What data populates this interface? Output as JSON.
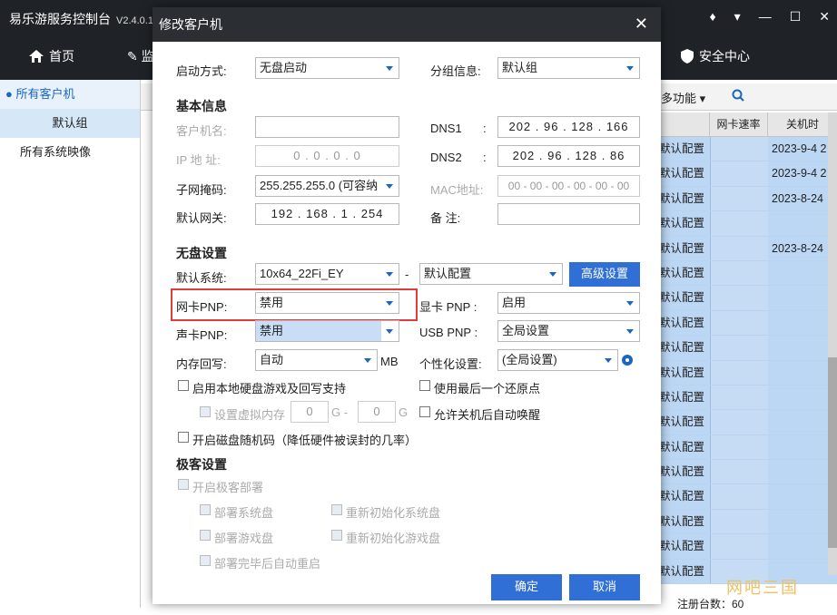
{
  "app": {
    "title": "易乐游服务控制台",
    "version": "V2.4.0.1",
    "nav_home": "首页",
    "nav_second": "监",
    "nav_security": "安全中心"
  },
  "sidebar": {
    "all_clients": "所有客户机",
    "default_group": "默认组",
    "all_images": "所有系统映像"
  },
  "background_table": {
    "more_func": "多功能 ▾",
    "headers": [
      "",
      "网卡速率",
      "关机时"
    ],
    "rows": [
      {
        "config": "默认配置",
        "time": "2023-9-4 2"
      },
      {
        "config": "默认配置",
        "time": "2023-9-4 2"
      },
      {
        "config": "默认配置",
        "time": "2023-8-24"
      },
      {
        "config": "默认配置",
        "time": ""
      },
      {
        "config": "默认配置",
        "time": "2023-8-24"
      },
      {
        "config": "默认配置",
        "time": ""
      },
      {
        "config": "默认配置",
        "time": ""
      },
      {
        "config": "默认配置",
        "time": ""
      },
      {
        "config": "默认配置",
        "time": ""
      },
      {
        "config": "默认配置",
        "time": ""
      },
      {
        "config": "默认配置",
        "time": ""
      },
      {
        "config": "默认配置",
        "time": ""
      },
      {
        "config": "默认配置",
        "time": ""
      },
      {
        "config": "默认配置",
        "time": ""
      },
      {
        "config": "默认配置",
        "time": ""
      },
      {
        "config": "默认配置",
        "time": ""
      },
      {
        "config": "默认配置",
        "time": ""
      },
      {
        "config": "默认配置",
        "time": ""
      }
    ],
    "status": "注册台数：60",
    "watermark": "网吧三国"
  },
  "dialog": {
    "title": "修改客户机",
    "boot_mode_label": "启动方式:",
    "boot_mode_value": "无盘启动",
    "group_label": "分组信息:",
    "group_value": "默认组",
    "basic_info_title": "基本信息",
    "client_name_label": "客户机名:",
    "client_name_value": "",
    "ip_label": "IP 地 址:",
    "ip_value": "0 . 0 . 0 . 0",
    "subnet_label": "子网掩码:",
    "subnet_value": "255.255.255.0 (可容纳",
    "gateway_label": "默认网关:",
    "gateway_value": "192 . 168 . 1 . 254",
    "dns1_label": "DNS1",
    "dns1_value": "202 . 96 . 128 . 166",
    "dns2_label": "DNS2",
    "dns2_value": "202 . 96 . 128 . 86",
    "mac_label": "MAC地址:",
    "mac_value": "00 - 00 - 00 - 00 - 00 - 00",
    "remark_label": "备 注:",
    "remark_value": "",
    "diskless_title": "无盘设置",
    "default_system_label": "默认系统:",
    "default_system_value": "10x64_22Fi_EY",
    "dash": "-",
    "default_config_value": "默认配置",
    "advanced_button": "高级设置",
    "nic_pnp_label": "网卡PNP:",
    "nic_pnp_value": "禁用",
    "gpu_pnp_label": "显卡 PNP :",
    "gpu_pnp_value": "启用",
    "sound_pnp_label": "声卡PNP:",
    "sound_pnp_value": "禁用",
    "usb_pnp_label": "USB PNP :",
    "usb_pnp_value": "全局设置",
    "mem_writeback_label": "内存回写:",
    "mem_writeback_value": "自动",
    "mb_unit": "MB",
    "personalize_label": "个性化设置:",
    "personalize_value": "(全局设置)",
    "local_disk_game_label": "启用本地硬盘游戏及回写支持",
    "last_restore_label": "使用最后一个还原点",
    "virtual_mem_label": "设置虚拟内存",
    "virtual_mem_value1": "0",
    "g_dash": "G -",
    "virtual_mem_value2": "0",
    "g_unit": "G",
    "auto_wake_label": "允许关机后自动唤醒",
    "disk_random_label": "开启磁盘随机码（降低硬件被误封的几率）",
    "jike_title": "极客设置",
    "enable_jike_label": "开启极客部署",
    "deploy_system_label": "部署系统盘",
    "reinit_system_label": "重新初始化系统盘",
    "deploy_game_label": "部署游戏盘",
    "reinit_game_label": "重新初始化游戏盘",
    "auto_restart_label": "部署完毕后自动重启",
    "ok_button": "确定",
    "cancel_button": "取消"
  }
}
